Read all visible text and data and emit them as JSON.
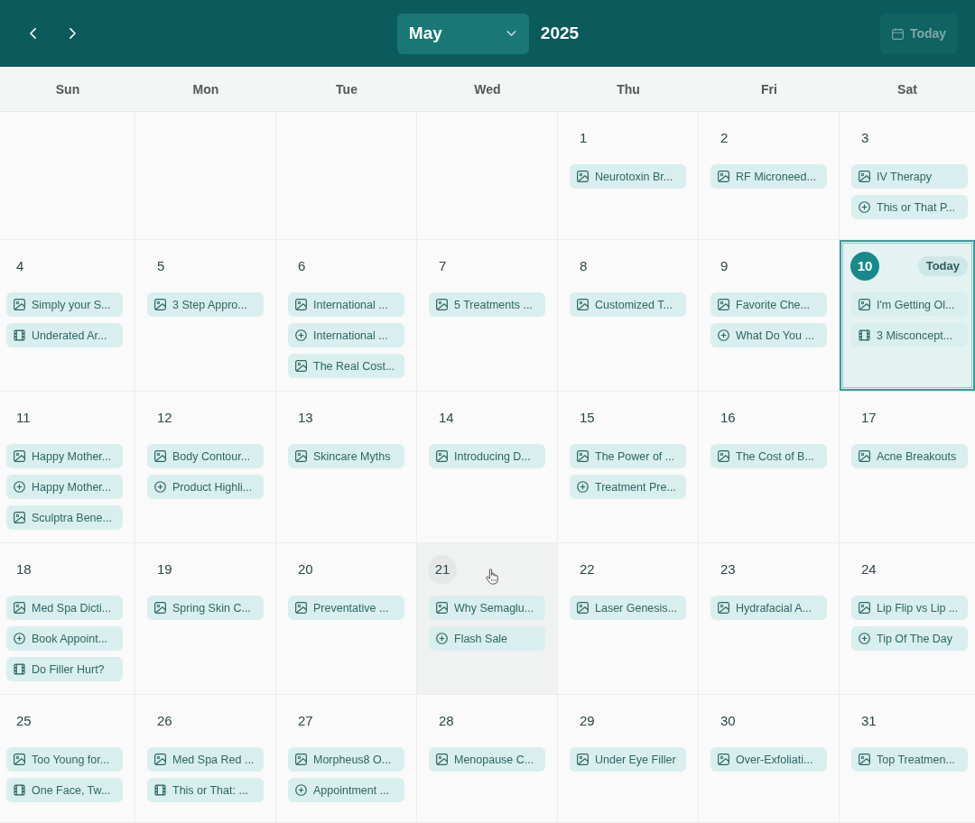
{
  "header": {
    "month": "May",
    "year": "2025",
    "today_button": {
      "label": "Today",
      "disabled": true
    }
  },
  "weekdays": [
    "Sun",
    "Mon",
    "Tue",
    "Wed",
    "Thu",
    "Fri",
    "Sat"
  ],
  "weeks": [
    {
      "days": [
        {
          "number": "1",
          "today": false,
          "hovered": false,
          "events": [
            {
              "kind": "image",
              "title": "Neurotoxin Br..."
            }
          ]
        },
        {
          "number": "2",
          "today": false,
          "hovered": false,
          "events": [
            {
              "kind": "image",
              "title": "RF Microneed..."
            }
          ]
        },
        {
          "number": "3",
          "today": false,
          "hovered": false,
          "events": [
            {
              "kind": "image",
              "title": "IV Therapy"
            },
            {
              "kind": "plus",
              "title": "This or That P..."
            }
          ]
        }
      ]
    },
    {
      "days": [
        {
          "number": "4",
          "today": false,
          "hovered": false,
          "events": [
            {
              "kind": "image",
              "title": "Simply your S..."
            },
            {
              "kind": "film",
              "title": "Underated Ar..."
            }
          ]
        },
        {
          "number": "5",
          "today": false,
          "hovered": false,
          "events": [
            {
              "kind": "image",
              "title": "3 Step Appro..."
            }
          ]
        },
        {
          "number": "6",
          "today": false,
          "hovered": false,
          "events": [
            {
              "kind": "image",
              "title": "International ..."
            },
            {
              "kind": "plus",
              "title": "International ..."
            },
            {
              "kind": "image",
              "title": "The Real Cost..."
            }
          ]
        },
        {
          "number": "7",
          "today": false,
          "hovered": false,
          "events": [
            {
              "kind": "image",
              "title": "5 Treatments ..."
            }
          ]
        },
        {
          "number": "8",
          "today": false,
          "hovered": false,
          "events": [
            {
              "kind": "image",
              "title": "Customized T..."
            }
          ]
        },
        {
          "number": "9",
          "today": false,
          "hovered": false,
          "events": [
            {
              "kind": "image",
              "title": "Favorite Che..."
            },
            {
              "kind": "plus",
              "title": "What Do You ..."
            }
          ]
        },
        {
          "number": "10",
          "today": true,
          "today_label": "Today",
          "hovered": false,
          "events": [
            {
              "kind": "image",
              "title": "I'm Getting Ol..."
            },
            {
              "kind": "film",
              "title": "3 Misconcept..."
            }
          ]
        }
      ]
    },
    {
      "days": [
        {
          "number": "11",
          "today": false,
          "hovered": false,
          "events": [
            {
              "kind": "image",
              "title": "Happy Mother..."
            },
            {
              "kind": "plus",
              "title": "Happy Mother..."
            },
            {
              "kind": "image",
              "title": "Sculptra Bene..."
            }
          ]
        },
        {
          "number": "12",
          "today": false,
          "hovered": false,
          "events": [
            {
              "kind": "image",
              "title": "Body Contour..."
            },
            {
              "kind": "plus",
              "title": "Product Highli..."
            }
          ]
        },
        {
          "number": "13",
          "today": false,
          "hovered": false,
          "events": [
            {
              "kind": "image",
              "title": "Skincare Myths"
            }
          ]
        },
        {
          "number": "14",
          "today": false,
          "hovered": false,
          "events": [
            {
              "kind": "image",
              "title": "Introducing D..."
            }
          ]
        },
        {
          "number": "15",
          "today": false,
          "hovered": false,
          "events": [
            {
              "kind": "image",
              "title": "The Power of ..."
            },
            {
              "kind": "plus",
              "title": "Treatment Pre..."
            }
          ]
        },
        {
          "number": "16",
          "today": false,
          "hovered": false,
          "events": [
            {
              "kind": "image",
              "title": "The Cost of B..."
            }
          ]
        },
        {
          "number": "17",
          "today": false,
          "hovered": false,
          "events": [
            {
              "kind": "image",
              "title": "Acne Breakouts"
            }
          ]
        }
      ]
    },
    {
      "days": [
        {
          "number": "18",
          "today": false,
          "hovered": false,
          "events": [
            {
              "kind": "image",
              "title": "Med Spa Dicti..."
            },
            {
              "kind": "plus",
              "title": "Book Appoint..."
            },
            {
              "kind": "film",
              "title": "Do Filler Hurt?"
            }
          ]
        },
        {
          "number": "19",
          "today": false,
          "hovered": false,
          "events": [
            {
              "kind": "image",
              "title": "Spring Skin C..."
            }
          ]
        },
        {
          "number": "20",
          "today": false,
          "hovered": false,
          "events": [
            {
              "kind": "image",
              "title": "Preventative ..."
            }
          ]
        },
        {
          "number": "21",
          "today": false,
          "hovered": true,
          "events": [
            {
              "kind": "image",
              "title": "Why Semaglu..."
            },
            {
              "kind": "plus",
              "title": "Flash Sale"
            }
          ]
        },
        {
          "number": "22",
          "today": false,
          "hovered": false,
          "events": [
            {
              "kind": "image",
              "title": "Laser Genesis..."
            }
          ]
        },
        {
          "number": "23",
          "today": false,
          "hovered": false,
          "events": [
            {
              "kind": "image",
              "title": "Hydrafacial A..."
            }
          ]
        },
        {
          "number": "24",
          "today": false,
          "hovered": false,
          "events": [
            {
              "kind": "image",
              "title": "Lip Flip vs Lip ..."
            },
            {
              "kind": "plus",
              "title": "Tip Of The Day"
            }
          ]
        }
      ]
    },
    {
      "days": [
        {
          "number": "25",
          "today": false,
          "hovered": false,
          "events": [
            {
              "kind": "image",
              "title": "Too Young for..."
            },
            {
              "kind": "film",
              "title": "One Face, Tw..."
            }
          ]
        },
        {
          "number": "26",
          "today": false,
          "hovered": false,
          "events": [
            {
              "kind": "image",
              "title": "Med Spa Red ..."
            },
            {
              "kind": "film",
              "title": "This or That: ..."
            }
          ]
        },
        {
          "number": "27",
          "today": false,
          "hovered": false,
          "events": [
            {
              "kind": "image",
              "title": "Morpheus8 O..."
            },
            {
              "kind": "plus",
              "title": "Appointment ..."
            }
          ]
        },
        {
          "number": "28",
          "today": false,
          "hovered": false,
          "events": [
            {
              "kind": "image",
              "title": "Menopause C..."
            }
          ]
        },
        {
          "number": "29",
          "today": false,
          "hovered": false,
          "events": [
            {
              "kind": "image",
              "title": "Under Eye Filler"
            }
          ]
        },
        {
          "number": "30",
          "today": false,
          "hovered": false,
          "events": [
            {
              "kind": "image",
              "title": "Over-Exfoliati..."
            }
          ]
        },
        {
          "number": "31",
          "today": false,
          "hovered": false,
          "events": [
            {
              "kind": "image",
              "title": "Top Treatmen..."
            }
          ]
        }
      ]
    }
  ]
}
